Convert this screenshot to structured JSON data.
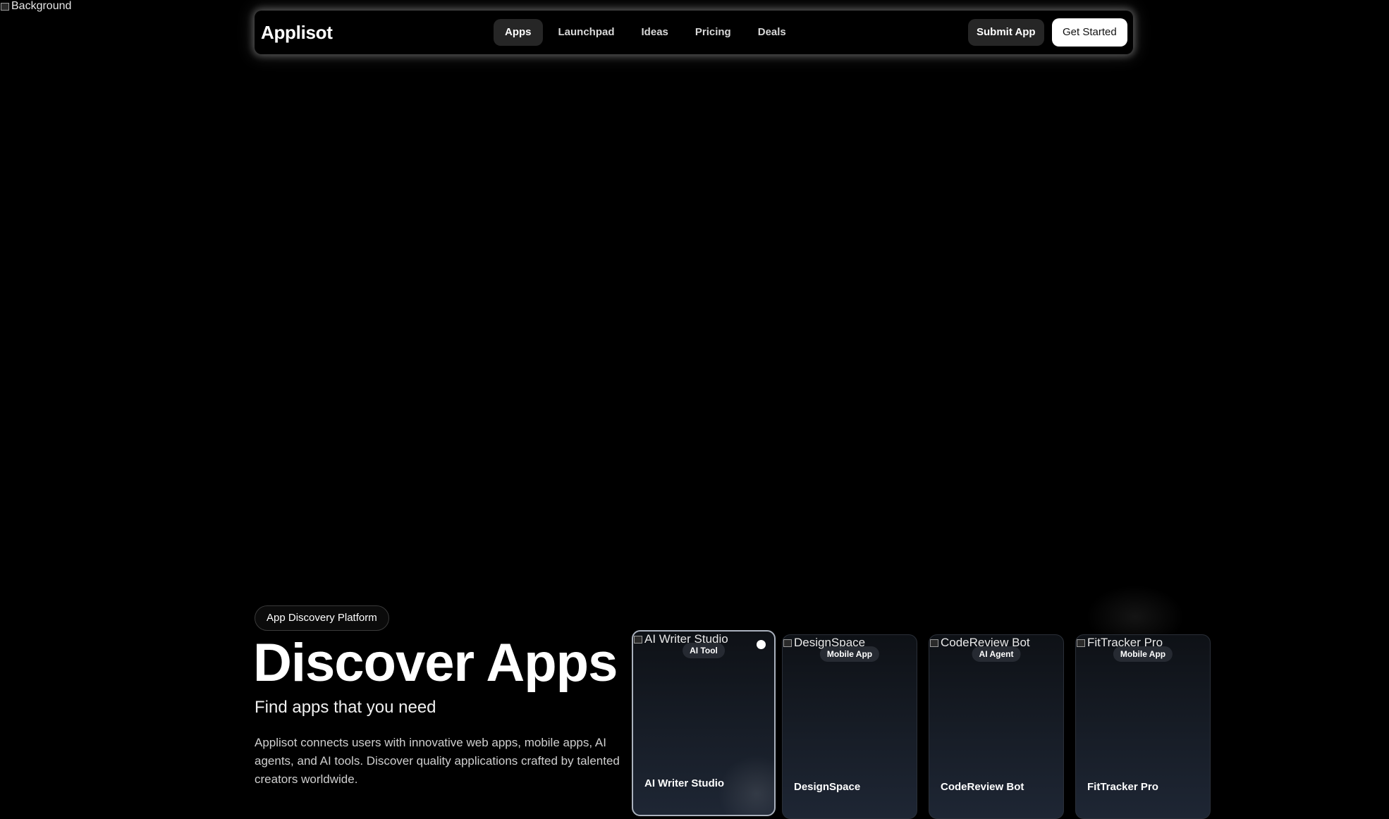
{
  "background": {
    "alt_text": "Background"
  },
  "navbar": {
    "brand": "Applisot",
    "links": [
      {
        "label": "Apps",
        "active": true
      },
      {
        "label": "Launchpad",
        "active": false
      },
      {
        "label": "Ideas",
        "active": false
      },
      {
        "label": "Pricing",
        "active": false
      },
      {
        "label": "Deals",
        "active": false
      }
    ],
    "submit_label": "Submit App",
    "cta_label": "Get Started"
  },
  "hero": {
    "badge": "App Discovery Platform",
    "title": "Discover Apps",
    "subtitle": "Find apps that you need",
    "description": "Applisot connects users with innovative web apps, mobile apps, AI agents, and AI tools. Discover quality applications crafted by talented creators worldwide."
  },
  "cards": [
    {
      "image_alt": "AI Writer Studio",
      "category": "AI Tool",
      "title": "AI Writer Studio"
    },
    {
      "image_alt": "DesignSpace",
      "category": "Mobile App",
      "title": "DesignSpace"
    },
    {
      "image_alt": "CodeReview Bot",
      "category": "AI Agent",
      "title": "CodeReview Bot"
    },
    {
      "image_alt": "FitTracker Pro",
      "category": "Mobile App",
      "title": "FitTracker Pro"
    }
  ],
  "colors": {
    "page_bg": "#000000",
    "card_border_featured": "#aab1bd",
    "active_tab": "#262626"
  }
}
